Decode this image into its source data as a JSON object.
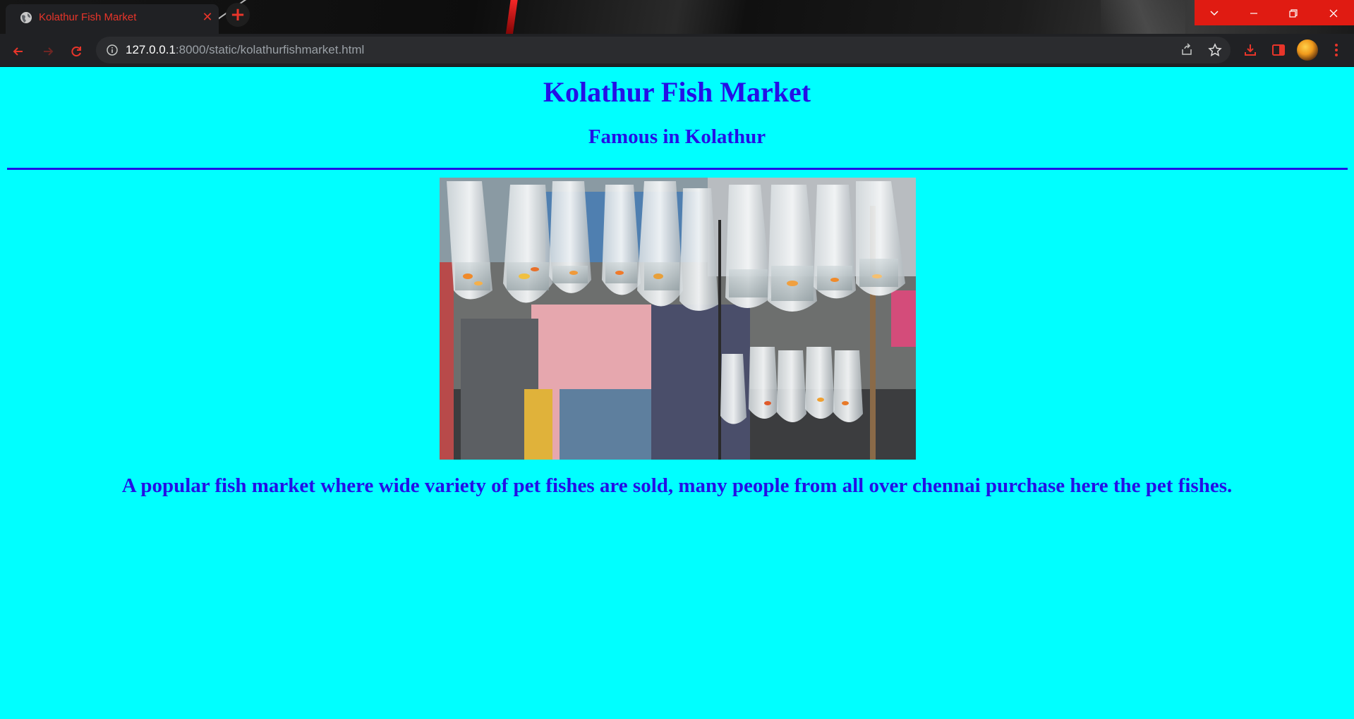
{
  "browser": {
    "tab": {
      "title": "Kolathur Fish Market",
      "close_icon": "close-icon",
      "favicon": "globe-icon"
    },
    "new_tab_icon": "plus-icon",
    "window_controls": [
      "chevron-down-icon",
      "minimize-icon",
      "restore-icon",
      "close-icon"
    ],
    "nav": {
      "back_icon": "arrow-left-icon",
      "forward_icon": "arrow-right-icon",
      "reload_icon": "reload-icon"
    },
    "address_bar": {
      "host": "127.0.0.1",
      "path": ":8000/static/kolathurfishmarket.html",
      "info_icon": "info-icon"
    },
    "toolbar_icons": [
      "share-icon",
      "star-icon",
      "download-icon",
      "side-panel-icon",
      "avatar",
      "more-menu-icon"
    ],
    "accent_color": "#e8352a"
  },
  "page": {
    "background_color": "#00ffff",
    "text_color": "#2410e6",
    "heading": "Kolathur Fish Market",
    "subheading": "Famous in Kolathur",
    "description": "A popular fish market where wide variety of pet fishes are sold, many people from all over chennai purchase here the pet fishes."
  }
}
